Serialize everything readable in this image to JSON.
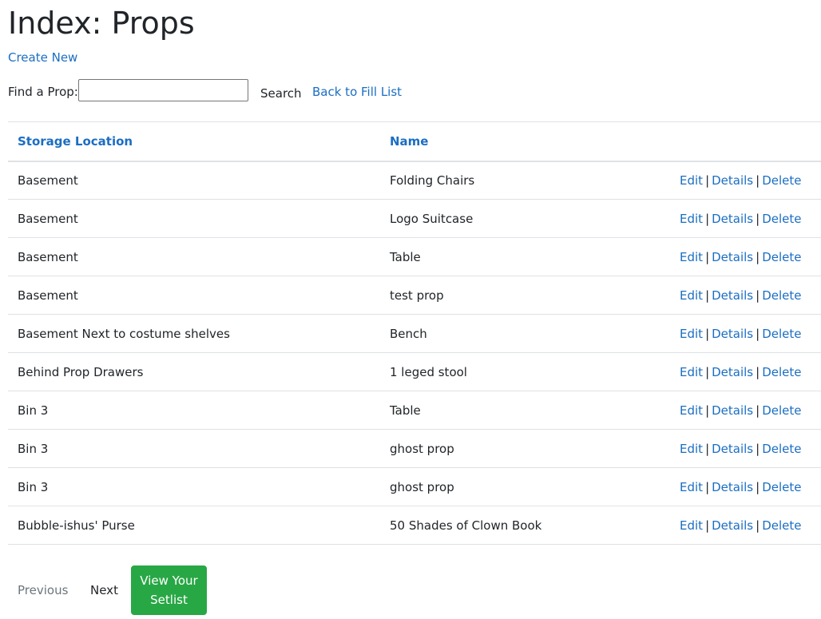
{
  "page": {
    "title": "Index: Props",
    "create_new_label": "Create New"
  },
  "search": {
    "label": "Find a Prop:",
    "value": "",
    "placeholder": "",
    "button_label": "Search",
    "back_link_label": "Back to Fill List"
  },
  "table": {
    "columns": [
      "Storage Location",
      "Name",
      ""
    ],
    "actions": {
      "edit": "Edit",
      "details": "Details",
      "delete": "Delete",
      "separator": "|"
    },
    "rows": [
      {
        "location": "Basement",
        "name": "Folding Chairs"
      },
      {
        "location": "Basement",
        "name": "Logo Suitcase"
      },
      {
        "location": "Basement",
        "name": "Table"
      },
      {
        "location": "Basement",
        "name": "test prop"
      },
      {
        "location": "Basement Next to costume shelves",
        "name": "Bench"
      },
      {
        "location": "Behind Prop Drawers",
        "name": "1 leged stool"
      },
      {
        "location": "Bin 3",
        "name": "Table"
      },
      {
        "location": "Bin 3",
        "name": "ghost prop"
      },
      {
        "location": "Bin 3",
        "name": "ghost prop"
      },
      {
        "location": "Bubble-ishus' Purse",
        "name": "50 Shades of Clown Book"
      }
    ]
  },
  "pager": {
    "previous_label": "Previous",
    "next_label": "Next",
    "setlist_label": "View Your Setlist"
  },
  "colors": {
    "link": "#1b6ec2",
    "text": "#212529",
    "muted": "#6c757d",
    "border": "#dee2e6",
    "success_button": "#28a745"
  }
}
